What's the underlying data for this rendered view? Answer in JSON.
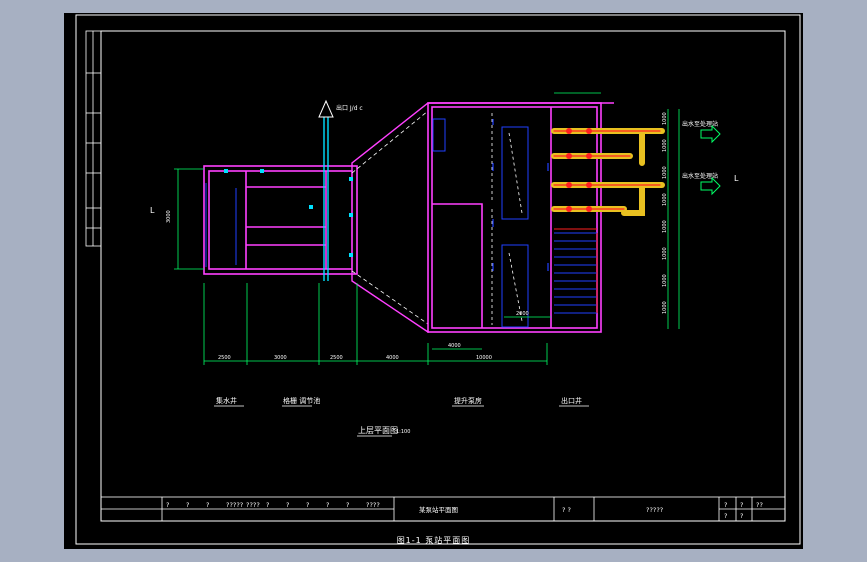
{
  "colors": {
    "background": "#a7b0c2",
    "sheet": "#000000",
    "frame": "#ffffff",
    "wall": "#ff40ff",
    "dimension": "#00ff66",
    "pipe_yellow": "#e8c020",
    "pipe_red": "#ff2020",
    "blue": "#2040ff",
    "cyan": "#00e0ff"
  },
  "labels": {
    "left_mark": "L",
    "right_mark": "L",
    "top_arrow": "出口 J/d c",
    "outlet_1": "出水至处理站",
    "outlet_2": "出水至处理站",
    "section_1": "集水井",
    "section_2": "格栅 调节池",
    "section_3": "提升泵房",
    "section_4": "出口井",
    "plan_title": "上层平面图",
    "plan_scale": "1:100",
    "bottom_caption": "图1-1 泵站平面图"
  },
  "dimensions": {
    "bottom": [
      "2500",
      "3000",
      "2500",
      "4000",
      "10000"
    ],
    "left_vertical": [
      "3000"
    ],
    "right_vertical": [
      "1000",
      "1000",
      "1000",
      "1000",
      "1000",
      "1000",
      "1000",
      "1000"
    ],
    "inner_bottom": [
      "4000",
      "2000"
    ]
  },
  "title_block": {
    "row1": [
      "?",
      "?",
      "?",
      "?????",
      "????",
      "?",
      "?",
      "?",
      "?",
      "?",
      "????"
    ],
    "drawing_name": "某泵站平面图",
    "project": "?  ?",
    "number": "?????",
    "sheet": [
      "?",
      "?",
      "??"
    ],
    "sheet_row2": [
      "?",
      "?"
    ]
  }
}
